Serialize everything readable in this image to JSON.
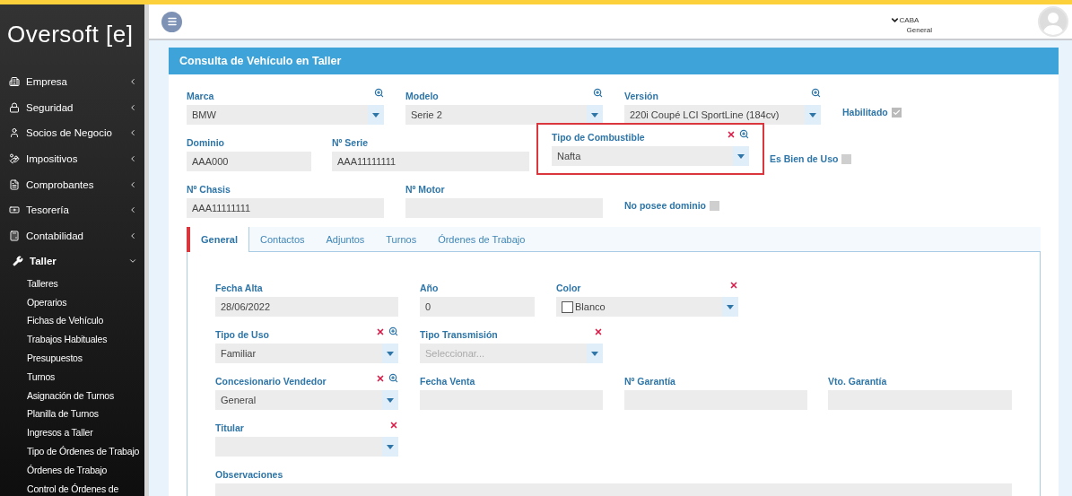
{
  "header": {
    "location": "CABA",
    "branch": "General"
  },
  "sidebar": {
    "logo": "Oversoft [e]",
    "items": [
      {
        "label": "Empresa",
        "expanded": false
      },
      {
        "label": "Seguridad",
        "expanded": false
      },
      {
        "label": "Socios de Negocio",
        "expanded": false
      },
      {
        "label": "Impositivos",
        "expanded": false
      },
      {
        "label": "Comprobantes",
        "expanded": false
      },
      {
        "label": "Tesorería",
        "expanded": false
      },
      {
        "label": "Contabilidad",
        "expanded": false
      },
      {
        "label": "Taller",
        "expanded": true,
        "children": [
          {
            "label": "Talleres"
          },
          {
            "label": "Operarios"
          },
          {
            "label": "Fichas de Vehículo"
          },
          {
            "label": "Trabajos Habituales"
          },
          {
            "label": "Presupuestos"
          },
          {
            "label": "Turnos"
          },
          {
            "label": "Asignación de Turnos"
          },
          {
            "label": "Planilla de Turnos"
          },
          {
            "label": "Ingresos a Taller"
          },
          {
            "label": "Tipo de Órdenes de Trabajo"
          },
          {
            "label": "Órdenes de Trabajo"
          },
          {
            "label": "Control de Órdenes de"
          }
        ]
      }
    ]
  },
  "page_title": "Consulta de Vehículo en Taller",
  "top_rows": [
    [
      {
        "kind": "select",
        "label": "Marca",
        "value": "BMW",
        "searchable": true
      },
      {
        "kind": "select",
        "label": "Modelo",
        "value": "Serie 2",
        "searchable": true
      },
      {
        "kind": "select",
        "label": "Versión",
        "value": "220i Coupé LCI SportLine (184cv)",
        "searchable": true
      },
      {
        "kind": "checkbox",
        "label": "Habilitado",
        "checked": true
      }
    ],
    [
      {
        "kind": "text",
        "label": "Dominio",
        "value": "AAA000"
      },
      {
        "kind": "text",
        "label": "Nº Serie",
        "value": "AAA11111111"
      },
      {
        "kind": "select",
        "label": "Tipo de Combustible",
        "value": "Nafta",
        "clearable": true,
        "searchable": true,
        "highlighted": true
      },
      {
        "kind": "checkbox",
        "label": "Es Bien de Uso",
        "checked": false
      }
    ],
    [
      {
        "kind": "text",
        "label": "Nº Chasis",
        "value": "AAA11111111"
      },
      {
        "kind": "text",
        "label": "Nº Motor"
      },
      {
        "kind": "checkbox",
        "label": "No posee dominio",
        "checked": false
      }
    ]
  ],
  "tabs": [
    {
      "label": "General",
      "selected": true
    },
    {
      "label": "Contactos",
      "selected": false
    },
    {
      "label": "Adjuntos",
      "selected": false
    },
    {
      "label": "Turnos",
      "selected": false
    },
    {
      "label": "Órdenes de Trabajo",
      "selected": false
    }
  ],
  "tab_rows": [
    [
      {
        "kind": "text",
        "label": "Fecha Alta",
        "value": "28/06/2022"
      },
      {
        "kind": "text",
        "label": "Año",
        "value": "0"
      },
      {
        "kind": "color-select",
        "label": "Color",
        "value": "Blanco",
        "clearable": true
      }
    ],
    [
      {
        "kind": "select",
        "label": "Tipo de Uso",
        "value": "Familiar",
        "clearable": true,
        "searchable": true
      },
      {
        "kind": "select",
        "label": "Tipo Transmisión",
        "placeholder": "Seleccionar...",
        "clearable": true
      }
    ],
    [
      {
        "kind": "select",
        "label": "Concesionario Vendedor",
        "value": "General",
        "clearable": true,
        "searchable": true
      },
      {
        "kind": "text",
        "label": "Fecha Venta"
      },
      {
        "kind": "text",
        "label": "Nº Garantía"
      },
      {
        "kind": "text",
        "label": "Vto. Garantía"
      }
    ],
    [
      {
        "kind": "select",
        "label": "Titular",
        "clearable": true
      }
    ],
    [
      {
        "kind": "text",
        "label": "Observaciones"
      }
    ]
  ]
}
